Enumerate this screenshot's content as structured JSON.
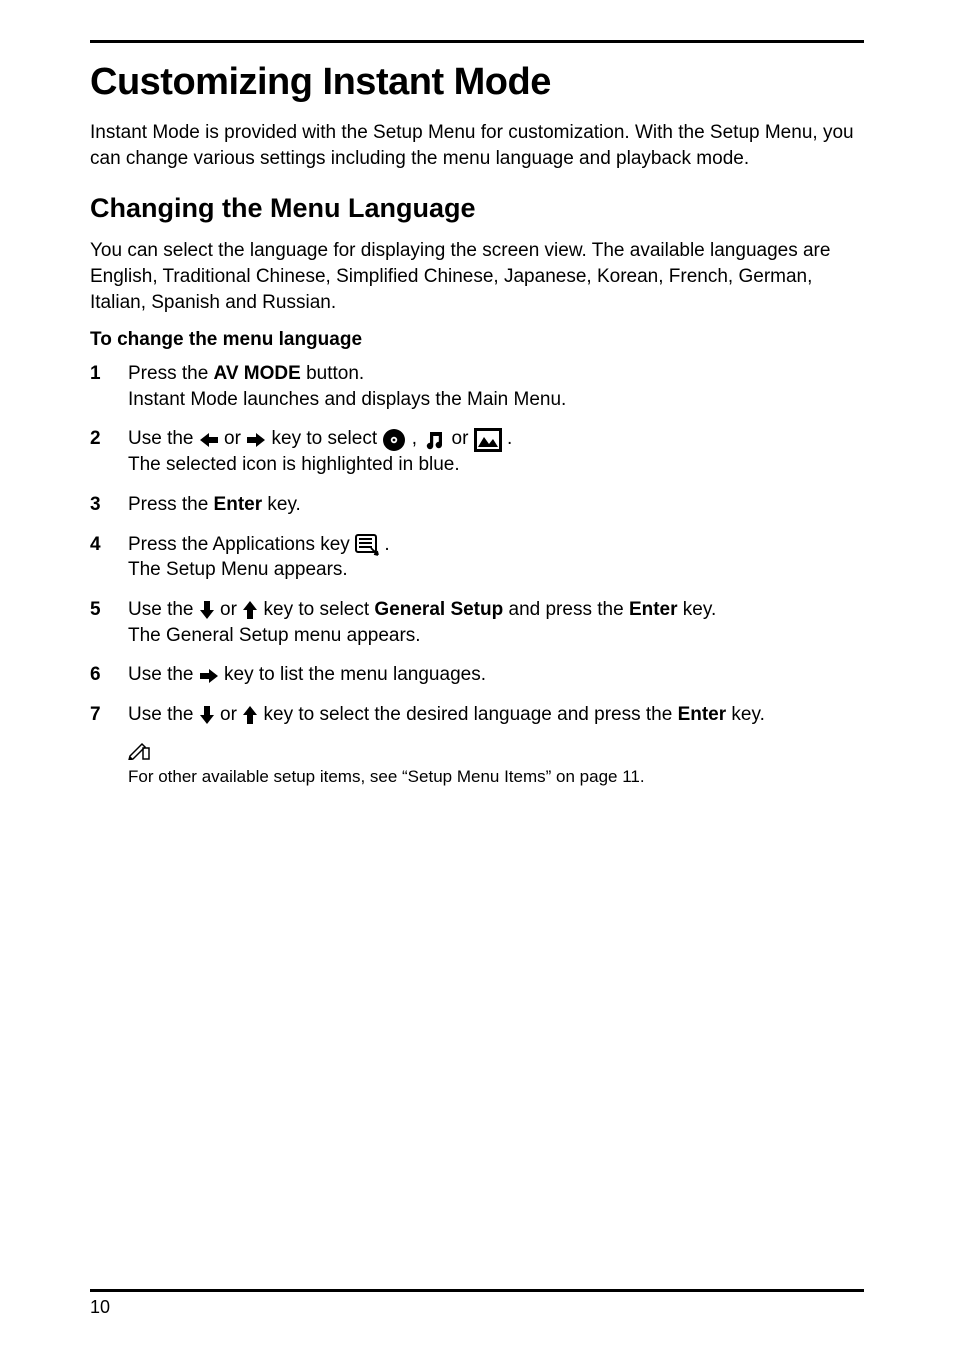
{
  "title": "Customizing Instant Mode",
  "intro": "Instant Mode is provided with the Setup Menu for customization. With the Setup Menu, you can change various settings including the menu language and playback mode.",
  "h2": "Changing the Menu Language",
  "desc": "You can select the language for displaying the screen view. The available languages are English, Traditional Chinese, Simplified Chinese, Japanese, Korean, French, German, Italian, Spanish and Russian.",
  "sub": "To change the menu language",
  "steps": {
    "s1": {
      "num": "1",
      "a": "Press the ",
      "b": "AV MODE",
      "c": " button.",
      "line2": "Instant Mode launches and displays the Main Menu."
    },
    "s2": {
      "num": "2",
      "a": "Use the ",
      "b": " or ",
      "c": " key to select ",
      "d": " , ",
      "e": " or ",
      "f": " .",
      "line2": "The selected icon is highlighted in blue."
    },
    "s3": {
      "num": "3",
      "a": "Press the ",
      "b": "Enter",
      "c": " key."
    },
    "s4": {
      "num": "4",
      "a": "Press the Applications key ",
      "b": " .",
      "line2": "The Setup Menu appears."
    },
    "s5": {
      "num": "5",
      "a": "Use the ",
      "b": " or ",
      "c": " key to select ",
      "d": "General Setup",
      "e": " and press the ",
      "f": "Enter",
      "g": " key.",
      "line2": "The General Setup menu appears."
    },
    "s6": {
      "num": "6",
      "a": "Use the ",
      "b": " key to list the menu languages."
    },
    "s7": {
      "num": "7",
      "a": "Use the ",
      "b": " or ",
      "c": " key to select the desired language and press the ",
      "d": "Enter",
      "e": " key."
    }
  },
  "note": "For other available setup items, see “Setup Menu Items” on page 11.",
  "pageNumber": "10"
}
